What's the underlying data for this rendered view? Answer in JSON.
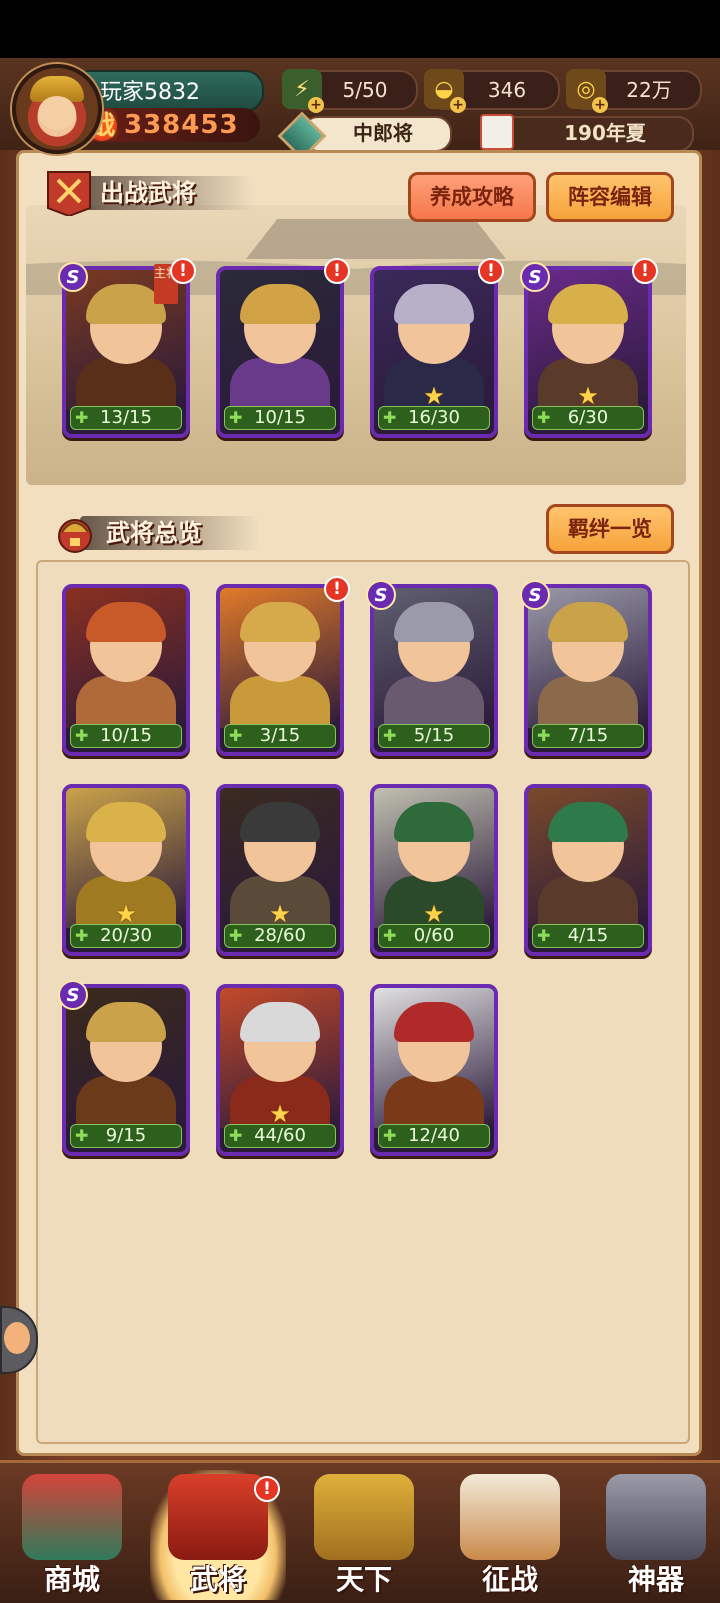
{
  "player": {
    "name": "玩家5832",
    "power_icon": "战",
    "power": "338453"
  },
  "resources": [
    {
      "icon": "stamina-scroll-icon",
      "value": "5/50"
    },
    {
      "icon": "gold-ingot-icon",
      "value": "346"
    },
    {
      "icon": "coin-icon",
      "value": "22万"
    }
  ],
  "rank": "中郎将",
  "date": "190年夏",
  "deployed": {
    "title": "出战武将",
    "buttons": {
      "guide": "养成攻略",
      "formation": "阵容编辑"
    },
    "cards": [
      {
        "fragments": "13/15",
        "s_rank": true,
        "alert": "!",
        "tag": "主将",
        "star": false
      },
      {
        "fragments": "10/15",
        "s_rank": false,
        "alert": "!",
        "star": false
      },
      {
        "fragments": "16/30",
        "s_rank": false,
        "alert": "!",
        "star": true
      },
      {
        "fragments": "6/30",
        "s_rank": true,
        "alert": "!",
        "star": true
      }
    ]
  },
  "overview": {
    "title": "武将总览",
    "button": "羁绊一览",
    "cards": [
      {
        "fragments": "10/15",
        "s_rank": false,
        "alert": "",
        "star": false
      },
      {
        "fragments": "3/15",
        "s_rank": false,
        "alert": "!",
        "star": false
      },
      {
        "fragments": "5/15",
        "s_rank": true,
        "alert": "",
        "star": false
      },
      {
        "fragments": "7/15",
        "s_rank": true,
        "alert": "",
        "star": false
      },
      {
        "fragments": "20/30",
        "s_rank": false,
        "alert": "",
        "star": true
      },
      {
        "fragments": "28/60",
        "s_rank": false,
        "alert": "",
        "star": true
      },
      {
        "fragments": "0/60",
        "s_rank": false,
        "alert": "",
        "star": true
      },
      {
        "fragments": "4/15",
        "s_rank": false,
        "alert": "",
        "star": false
      },
      {
        "fragments": "9/15",
        "s_rank": true,
        "alert": "",
        "star": false
      },
      {
        "fragments": "44/60",
        "s_rank": false,
        "alert": "",
        "star": true
      },
      {
        "fragments": "12/40",
        "s_rank": false,
        "alert": "",
        "star": false
      }
    ]
  },
  "nav": [
    {
      "label": "商城",
      "icon": "shop-pavilion-icon",
      "active": false
    },
    {
      "label": "武将",
      "icon": "general-helmet-icon",
      "active": true,
      "alert": "!"
    },
    {
      "label": "天下",
      "icon": "crossed-swords-icon",
      "active": false
    },
    {
      "label": "征战",
      "icon": "battle-flag-icon",
      "active": false
    },
    {
      "label": "神器",
      "icon": "artifact-armor-icon",
      "active": false
    }
  ],
  "colors": {
    "accent": "#f6a33a",
    "panel": "#f1dfc0",
    "card_border": "#6a2bb0",
    "alert": "#e53525"
  }
}
